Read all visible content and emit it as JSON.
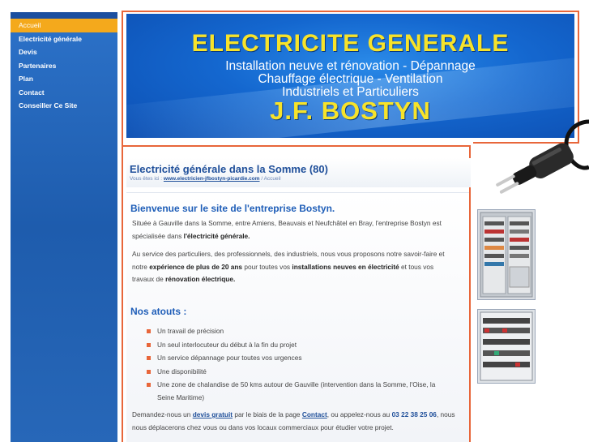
{
  "nav": {
    "items": [
      {
        "label": "Accueil",
        "active": true
      },
      {
        "label": "Electricité générale",
        "active": false
      },
      {
        "label": "Devis",
        "active": false
      },
      {
        "label": "Partenaires",
        "active": false
      },
      {
        "label": "Plan",
        "active": false
      },
      {
        "label": "Contact",
        "active": false
      },
      {
        "label": "Conseiller Ce Site",
        "active": false
      }
    ]
  },
  "banner": {
    "title": "ELECTRICITE GENERALE",
    "line1": "Installation neuve et rénovation - Dépannage",
    "line2": "Chauffage électrique - Ventilation",
    "line3": "Industriels et Particuliers",
    "name": "J.F. BOSTYN"
  },
  "page": {
    "heading": "Electricité générale dans la Somme (80)",
    "crumbs_prefix": "Vous êtes ici :",
    "crumbs_link": "www.electricien-jfbostyn-picardie.com",
    "crumbs_sep": "/",
    "crumbs_current": "Accueil"
  },
  "content": {
    "welcome": "Bienvenue sur le site de l'entreprise Bostyn.",
    "p1_a": "Située à Gauville dans la Somme, entre Amiens, Beauvais et Neufchâtel en Bray, l'entreprise Bostyn est spécialisée dans ",
    "p1_b": "l'électricité générale.",
    "p2_a": "Au service des particuliers, des professionnels, des industriels, nous vous proposons notre savoir-faire et notre ",
    "p2_b": "expérience de plus de 20 ans",
    "p2_c": " pour toutes vos ",
    "p2_d": "installations neuves en électricité",
    "p2_e": " et tous vos travaux de ",
    "p2_f": "rénovation électrique.",
    "atouts_title": "Nos atouts :",
    "atouts": [
      "Un travail de précision",
      "Un seul interlocuteur du début à la fin du projet",
      "Un service dépannage pour toutes vos urgences",
      "Une disponibilité",
      "Une zone de chalandise de 50 kms autour de Gauville (intervention dans la Somme, l'Oise, la Seine Maritime)"
    ],
    "p3_a": "Demandez-nous un ",
    "p3_link1": "devis gratuit",
    "p3_b": " par le biais de la page ",
    "p3_link2": "Contact",
    "p3_c": ", ou appelez-nous au ",
    "p3_phone": "03 22 38 25 06",
    "p3_d": ", nous nous déplacerons chez vous ou dans vos locaux commerciaux pour étudier votre projet."
  },
  "colors": {
    "accent_orange": "#e8663a",
    "nav_blue": "#1e5cad",
    "active_yellow": "#f4a91c",
    "banner_title_yellow": "#f7e32a",
    "heading_blue": "#1f5eb8"
  },
  "icons": [
    "power-plug-icon",
    "bullet-square-icon"
  ]
}
